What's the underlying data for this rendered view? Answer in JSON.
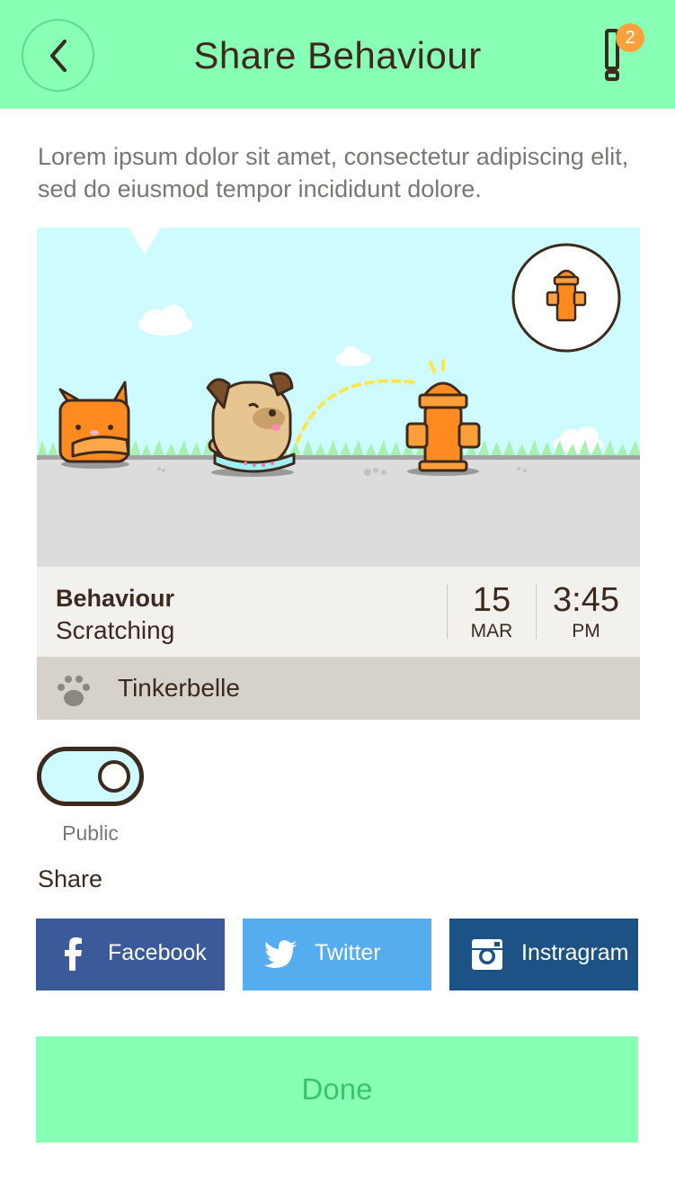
{
  "header": {
    "title": "Share Behaviour",
    "alert_count": "2"
  },
  "intro": {
    "text": "Lorem ipsum dolor sit amet, consectetur adipiscing elit, sed do eiusmod tempor incididunt dolore."
  },
  "card": {
    "behaviour_label": "Behaviour",
    "behaviour_value": "Scratching",
    "date_day": "15",
    "date_month": "MAR",
    "time": "3:45",
    "time_period": "PM",
    "pet_name": "Tinkerbelle"
  },
  "visibility": {
    "label": "Public",
    "enabled": true
  },
  "share": {
    "label": "Share",
    "buttons": [
      {
        "label": "Facebook",
        "icon": "facebook-icon",
        "color": "#3b5a9a"
      },
      {
        "label": "Twitter",
        "icon": "twitter-icon",
        "color": "#55acee"
      },
      {
        "label": "Instragram",
        "icon": "instagram-icon",
        "color": "#1d5286"
      }
    ]
  },
  "done": {
    "label": "Done"
  },
  "colors": {
    "accent": "#89ffb6",
    "text": "#3b2a1d",
    "badge": "#f9a13a",
    "sky": "#cdfbff",
    "hydrant": "#ff8a1f"
  }
}
